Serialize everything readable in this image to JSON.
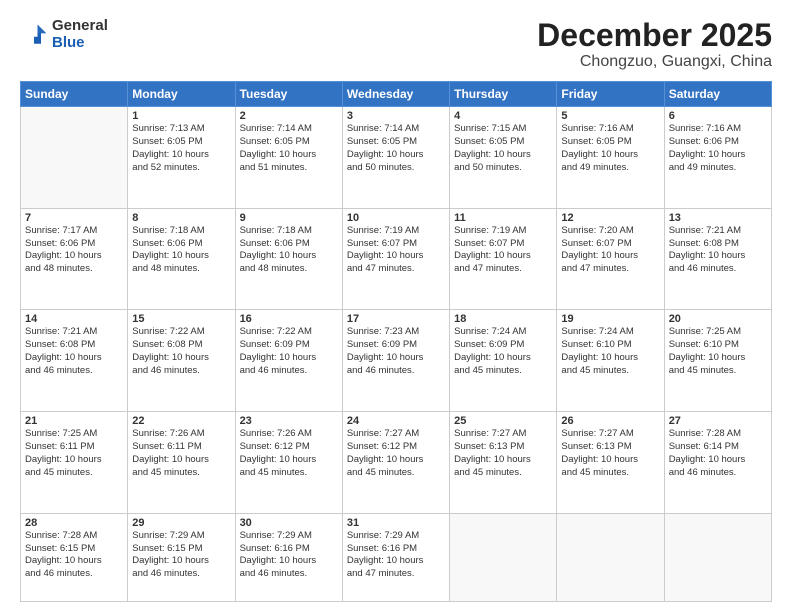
{
  "logo": {
    "general": "General",
    "blue": "Blue"
  },
  "title": "December 2025",
  "location": "Chongzuo, Guangxi, China",
  "weekdays": [
    "Sunday",
    "Monday",
    "Tuesday",
    "Wednesday",
    "Thursday",
    "Friday",
    "Saturday"
  ],
  "weeks": [
    [
      {
        "day": "",
        "info": ""
      },
      {
        "day": "1",
        "info": "Sunrise: 7:13 AM\nSunset: 6:05 PM\nDaylight: 10 hours\nand 52 minutes."
      },
      {
        "day": "2",
        "info": "Sunrise: 7:14 AM\nSunset: 6:05 PM\nDaylight: 10 hours\nand 51 minutes."
      },
      {
        "day": "3",
        "info": "Sunrise: 7:14 AM\nSunset: 6:05 PM\nDaylight: 10 hours\nand 50 minutes."
      },
      {
        "day": "4",
        "info": "Sunrise: 7:15 AM\nSunset: 6:05 PM\nDaylight: 10 hours\nand 50 minutes."
      },
      {
        "day": "5",
        "info": "Sunrise: 7:16 AM\nSunset: 6:05 PM\nDaylight: 10 hours\nand 49 minutes."
      },
      {
        "day": "6",
        "info": "Sunrise: 7:16 AM\nSunset: 6:06 PM\nDaylight: 10 hours\nand 49 minutes."
      }
    ],
    [
      {
        "day": "7",
        "info": "Sunrise: 7:17 AM\nSunset: 6:06 PM\nDaylight: 10 hours\nand 48 minutes."
      },
      {
        "day": "8",
        "info": "Sunrise: 7:18 AM\nSunset: 6:06 PM\nDaylight: 10 hours\nand 48 minutes."
      },
      {
        "day": "9",
        "info": "Sunrise: 7:18 AM\nSunset: 6:06 PM\nDaylight: 10 hours\nand 48 minutes."
      },
      {
        "day": "10",
        "info": "Sunrise: 7:19 AM\nSunset: 6:07 PM\nDaylight: 10 hours\nand 47 minutes."
      },
      {
        "day": "11",
        "info": "Sunrise: 7:19 AM\nSunset: 6:07 PM\nDaylight: 10 hours\nand 47 minutes."
      },
      {
        "day": "12",
        "info": "Sunrise: 7:20 AM\nSunset: 6:07 PM\nDaylight: 10 hours\nand 47 minutes."
      },
      {
        "day": "13",
        "info": "Sunrise: 7:21 AM\nSunset: 6:08 PM\nDaylight: 10 hours\nand 46 minutes."
      }
    ],
    [
      {
        "day": "14",
        "info": "Sunrise: 7:21 AM\nSunset: 6:08 PM\nDaylight: 10 hours\nand 46 minutes."
      },
      {
        "day": "15",
        "info": "Sunrise: 7:22 AM\nSunset: 6:08 PM\nDaylight: 10 hours\nand 46 minutes."
      },
      {
        "day": "16",
        "info": "Sunrise: 7:22 AM\nSunset: 6:09 PM\nDaylight: 10 hours\nand 46 minutes."
      },
      {
        "day": "17",
        "info": "Sunrise: 7:23 AM\nSunset: 6:09 PM\nDaylight: 10 hours\nand 46 minutes."
      },
      {
        "day": "18",
        "info": "Sunrise: 7:24 AM\nSunset: 6:09 PM\nDaylight: 10 hours\nand 45 minutes."
      },
      {
        "day": "19",
        "info": "Sunrise: 7:24 AM\nSunset: 6:10 PM\nDaylight: 10 hours\nand 45 minutes."
      },
      {
        "day": "20",
        "info": "Sunrise: 7:25 AM\nSunset: 6:10 PM\nDaylight: 10 hours\nand 45 minutes."
      }
    ],
    [
      {
        "day": "21",
        "info": "Sunrise: 7:25 AM\nSunset: 6:11 PM\nDaylight: 10 hours\nand 45 minutes."
      },
      {
        "day": "22",
        "info": "Sunrise: 7:26 AM\nSunset: 6:11 PM\nDaylight: 10 hours\nand 45 minutes."
      },
      {
        "day": "23",
        "info": "Sunrise: 7:26 AM\nSunset: 6:12 PM\nDaylight: 10 hours\nand 45 minutes."
      },
      {
        "day": "24",
        "info": "Sunrise: 7:27 AM\nSunset: 6:12 PM\nDaylight: 10 hours\nand 45 minutes."
      },
      {
        "day": "25",
        "info": "Sunrise: 7:27 AM\nSunset: 6:13 PM\nDaylight: 10 hours\nand 45 minutes."
      },
      {
        "day": "26",
        "info": "Sunrise: 7:27 AM\nSunset: 6:13 PM\nDaylight: 10 hours\nand 45 minutes."
      },
      {
        "day": "27",
        "info": "Sunrise: 7:28 AM\nSunset: 6:14 PM\nDaylight: 10 hours\nand 46 minutes."
      }
    ],
    [
      {
        "day": "28",
        "info": "Sunrise: 7:28 AM\nSunset: 6:15 PM\nDaylight: 10 hours\nand 46 minutes."
      },
      {
        "day": "29",
        "info": "Sunrise: 7:29 AM\nSunset: 6:15 PM\nDaylight: 10 hours\nand 46 minutes."
      },
      {
        "day": "30",
        "info": "Sunrise: 7:29 AM\nSunset: 6:16 PM\nDaylight: 10 hours\nand 46 minutes."
      },
      {
        "day": "31",
        "info": "Sunrise: 7:29 AM\nSunset: 6:16 PM\nDaylight: 10 hours\nand 47 minutes."
      },
      {
        "day": "",
        "info": ""
      },
      {
        "day": "",
        "info": ""
      },
      {
        "day": "",
        "info": ""
      }
    ]
  ]
}
